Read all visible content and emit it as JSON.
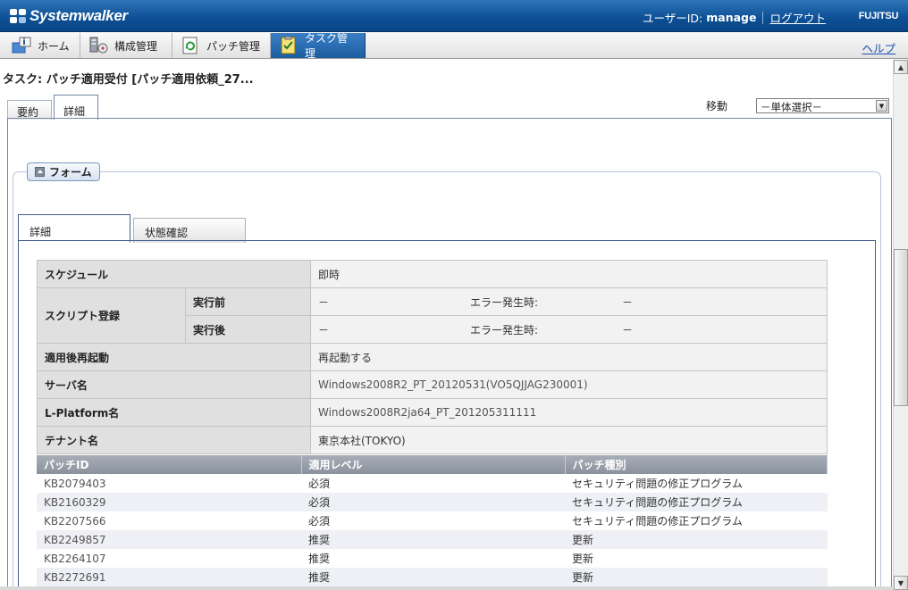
{
  "header": {
    "brand": "Systemwalker",
    "user_id_label": "ユーザーID:",
    "user_id": "manage",
    "logout": "ログアウト",
    "vendor": "FUJITSU"
  },
  "nav": {
    "items": [
      {
        "label": "ホーム",
        "icon": "home-icon"
      },
      {
        "label": "構成管理",
        "icon": "server-config-icon"
      },
      {
        "label": "パッチ管理",
        "icon": "patch-icon"
      },
      {
        "label": "タスク管理",
        "icon": "task-icon",
        "active": true
      }
    ],
    "help": "ヘルプ"
  },
  "page": {
    "title": "タスク: パッチ適用受付 [パッチ適用依頼_27...",
    "tabs": [
      "要約",
      "詳細"
    ],
    "active_tab": "詳細",
    "move_label": "移動",
    "move_select": "－単体選択－"
  },
  "form": {
    "legend": "フォーム",
    "tabs": [
      "詳細",
      "状態確認"
    ],
    "active_tab": "詳細"
  },
  "detail": {
    "schedule_label": "スケジュール",
    "schedule_value": "即時",
    "script_label": "スクリプト登録",
    "pre_label": "実行前",
    "pre_value": "－",
    "pre_error_label": "エラー発生時:",
    "pre_error_value": "－",
    "post_label": "実行後",
    "post_value": "－",
    "post_error_label": "エラー発生時:",
    "post_error_value": "－",
    "reboot_label": "適用後再起動",
    "reboot_value": "再起動する",
    "server_label": "サーバ名",
    "server_value": "Windows2008R2_PT_20120531(VO5QJJAG230001)",
    "lplatform_label": "L-Platform名",
    "lplatform_value": "Windows2008R2ja64_PT_201205311111",
    "tenant_label": "テナント名",
    "tenant_value": "東京本社(TOKYO)"
  },
  "patches": {
    "columns": [
      "パッチID",
      "適用レベル",
      "パッチ種別"
    ],
    "rows": [
      {
        "id": "KB2079403",
        "level": "必須",
        "type": "セキュリティ問題の修正プログラム"
      },
      {
        "id": "KB2160329",
        "level": "必須",
        "type": "セキュリティ問題の修正プログラム"
      },
      {
        "id": "KB2207566",
        "level": "必須",
        "type": "セキュリティ問題の修正プログラム"
      },
      {
        "id": "KB2249857",
        "level": "推奨",
        "type": "更新"
      },
      {
        "id": "KB2264107",
        "level": "推奨",
        "type": "更新"
      },
      {
        "id": "KB2272691",
        "level": "推奨",
        "type": "更新"
      }
    ]
  }
}
